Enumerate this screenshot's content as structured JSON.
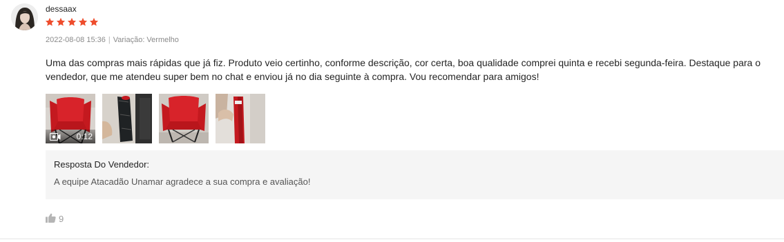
{
  "review": {
    "username": "dessaax",
    "rating": 5,
    "rating_max": 5,
    "star_color": "#ee4d2d",
    "date": "2022-08-08 15:36",
    "separator": "|",
    "variation": "Variação: Vermelho",
    "comment": "Uma das compras mais rápidas que já fiz. Produto veio certinho, conforme descrição, cor certa, boa qualidade comprei quinta e recebi segunda-feira. Destaque para o vendedor, que me atendeu super bem no chat e enviou já no dia seguinte à compra. Vou recomendar para amigos!",
    "media": [
      {
        "type": "video",
        "duration": "0:12",
        "icon": "video-camera-icon"
      },
      {
        "type": "image"
      },
      {
        "type": "image"
      },
      {
        "type": "image"
      }
    ]
  },
  "seller_reply": {
    "title": "Resposta Do Vendedor:",
    "text": "A equipe Atacadão Unamar agradece a sua compra e avaliação!"
  },
  "likes": {
    "icon": "thumbs-up-icon",
    "count": "9"
  }
}
